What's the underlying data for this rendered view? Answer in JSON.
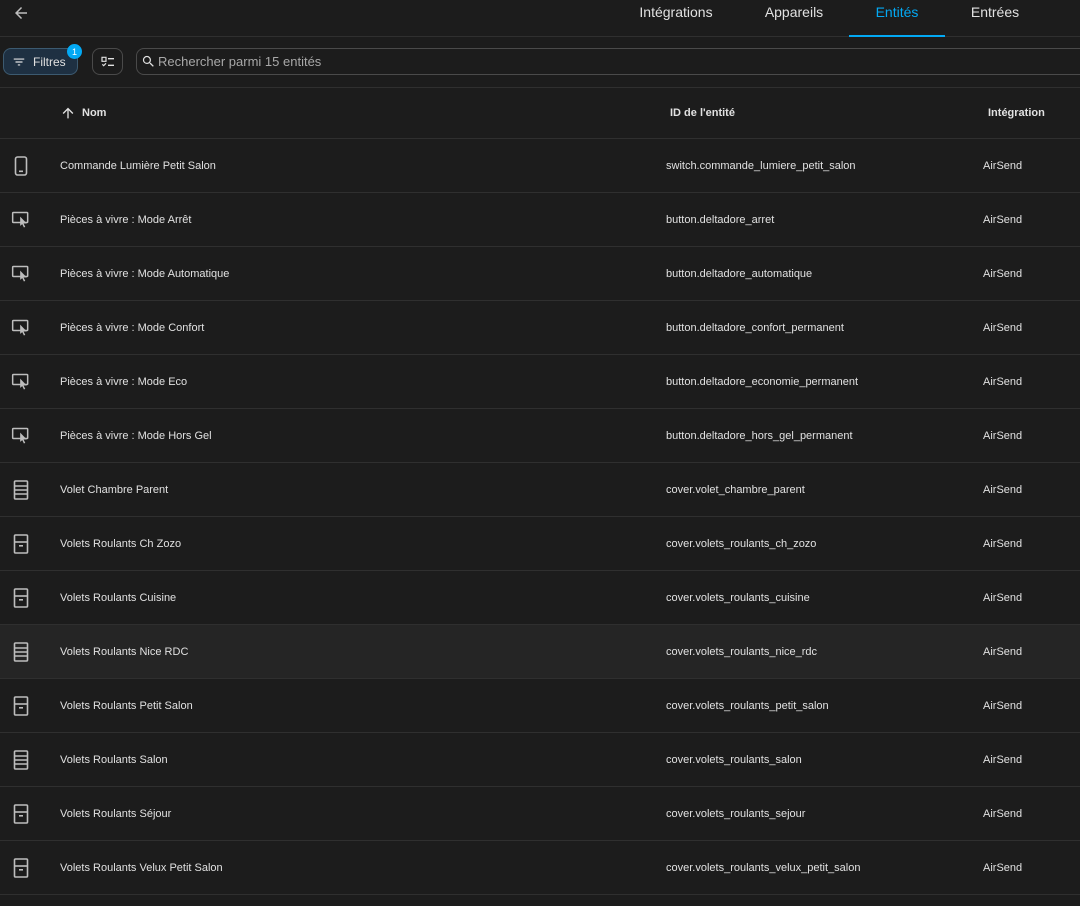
{
  "header": {
    "tabs": [
      {
        "label": "Intégrations"
      },
      {
        "label": "Appareils"
      },
      {
        "label": "Entités"
      },
      {
        "label": "Entrées"
      }
    ]
  },
  "toolbar": {
    "filters_label": "Filtres",
    "filters_count": "1",
    "search_placeholder": "Rechercher parmi 15 entités"
  },
  "table": {
    "columns": {
      "name": "Nom",
      "entity_id": "ID de l'entité",
      "integration": "Intégration"
    },
    "rows": [
      {
        "icon": "switch-icon",
        "name": "Commande Lumière Petit Salon",
        "entity_id": "switch.commande_lumiere_petit_salon",
        "integration": "AirSend"
      },
      {
        "icon": "button-press-icon",
        "name": "Pièces à vivre : Mode Arrêt",
        "entity_id": "button.deltadore_arret",
        "integration": "AirSend"
      },
      {
        "icon": "button-press-icon",
        "name": "Pièces à vivre : Mode Automatique",
        "entity_id": "button.deltadore_automatique",
        "integration": "AirSend"
      },
      {
        "icon": "button-press-icon",
        "name": "Pièces à vivre : Mode Confort",
        "entity_id": "button.deltadore_confort_permanent",
        "integration": "AirSend"
      },
      {
        "icon": "button-press-icon",
        "name": "Pièces à vivre : Mode Eco",
        "entity_id": "button.deltadore_economie_permanent",
        "integration": "AirSend"
      },
      {
        "icon": "button-press-icon",
        "name": "Pièces à vivre : Mode Hors Gel",
        "entity_id": "button.deltadore_hors_gel_permanent",
        "integration": "AirSend"
      },
      {
        "icon": "shutter-closed-icon",
        "name": "Volet Chambre Parent",
        "entity_id": "cover.volet_chambre_parent",
        "integration": "AirSend"
      },
      {
        "icon": "shutter-open-icon",
        "name": "Volets Roulants Ch Zozo",
        "entity_id": "cover.volets_roulants_ch_zozo",
        "integration": "AirSend"
      },
      {
        "icon": "shutter-open-icon",
        "name": "Volets Roulants Cuisine",
        "entity_id": "cover.volets_roulants_cuisine",
        "integration": "AirSend"
      },
      {
        "icon": "shutter-closed-icon",
        "name": "Volets Roulants Nice RDC",
        "entity_id": "cover.volets_roulants_nice_rdc",
        "integration": "AirSend"
      },
      {
        "icon": "shutter-open-icon",
        "name": "Volets Roulants Petit Salon",
        "entity_id": "cover.volets_roulants_petit_salon",
        "integration": "AirSend"
      },
      {
        "icon": "shutter-closed-icon",
        "name": "Volets Roulants Salon",
        "entity_id": "cover.volets_roulants_salon",
        "integration": "AirSend"
      },
      {
        "icon": "shutter-open-icon",
        "name": "Volets Roulants Séjour",
        "entity_id": "cover.volets_roulants_sejour",
        "integration": "AirSend"
      },
      {
        "icon": "shutter-open-icon",
        "name": "Volets Roulants Velux Petit Salon",
        "entity_id": "cover.volets_roulants_velux_petit_salon",
        "integration": "AirSend"
      }
    ]
  },
  "colors": {
    "accent": "#03a9f4",
    "background": "#1c1c1c",
    "divider": "#2f2f2f",
    "text": "#e1e1e1"
  }
}
